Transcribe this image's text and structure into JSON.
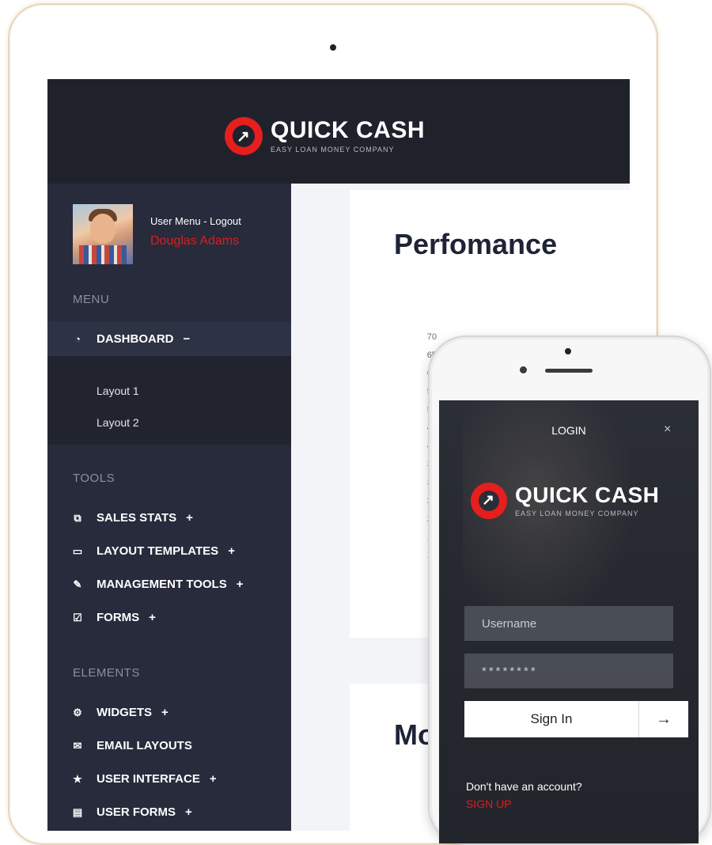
{
  "brand": {
    "name": "QUICK CASH",
    "tagline": "EASY LOAN MONEY COMPANY",
    "accent": "#e61e1e"
  },
  "sidebar": {
    "user_menu": "User Menu - Logout",
    "user_name": "Douglas Adams",
    "menu_title": "MENU",
    "dashboard": {
      "label": "DASHBOARD",
      "sign": "−",
      "icon": "gauge-icon",
      "sub": [
        "Layout 1",
        "Layout 2"
      ]
    },
    "tools_title": "TOOLS",
    "tools": [
      {
        "label": "SALES STATS",
        "sign": "+",
        "icon": "chart-icon"
      },
      {
        "label": "LAYOUT TEMPLATES",
        "sign": "+",
        "icon": "monitor-icon"
      },
      {
        "label": "MANAGEMENT TOOLS",
        "sign": "+",
        "icon": "wrench-icon"
      },
      {
        "label": "FORMS",
        "sign": "+",
        "icon": "checkbox-icon"
      }
    ],
    "elements_title": "ELEMENTS",
    "elements": [
      {
        "label": "WIDGETS",
        "sign": "+",
        "icon": "cogs-icon"
      },
      {
        "label": "EMAIL LAYOUTS",
        "sign": "",
        "icon": "envelope-icon"
      },
      {
        "label": "USER INTERFACE",
        "sign": "+",
        "icon": "star-icon"
      },
      {
        "label": "USER FORMS",
        "sign": "+",
        "icon": "form-icon"
      }
    ]
  },
  "main": {
    "performance_title": "Perfomance",
    "y_ticks": [
      "70",
      "65",
      "60",
      "55",
      "50",
      "45",
      "40",
      "35",
      "30",
      "25",
      "20",
      "15",
      "10",
      "5",
      "0"
    ],
    "second_title": "Mo"
  },
  "login": {
    "title": "LOGIN",
    "close": "×",
    "username_placeholder": "Username",
    "password_value": "********",
    "signin_label": "Sign In",
    "arrow": "→",
    "no_account": "Don't have an account?",
    "signup": "SIGN UP"
  }
}
